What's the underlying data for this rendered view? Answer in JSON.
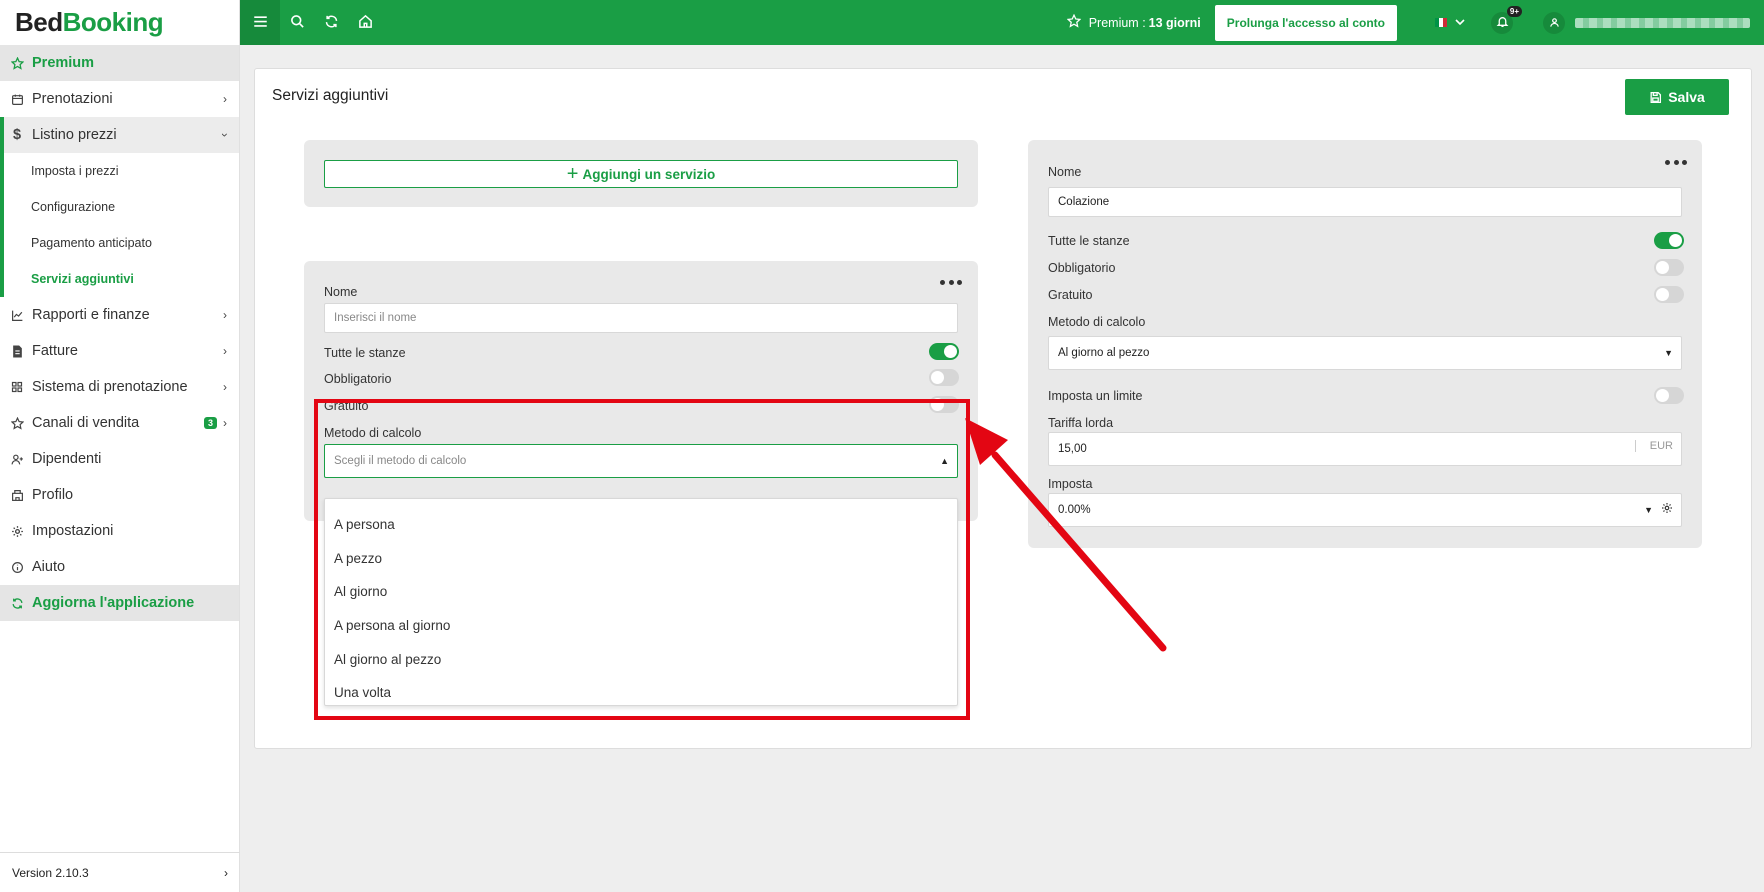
{
  "sidebar": {
    "logo_part1": "Bed",
    "logo_part2": "Booking",
    "premium": "Premium",
    "items": [
      {
        "label": "Prenotazioni"
      },
      {
        "label": "Listino prezzi"
      },
      {
        "label": "Rapporti e finanze"
      },
      {
        "label": "Fatture"
      },
      {
        "label": "Sistema di prenotazione"
      },
      {
        "label": "Canali di vendita",
        "badge": "3"
      },
      {
        "label": "Dipendenti"
      },
      {
        "label": "Profilo"
      },
      {
        "label": "Impostazioni"
      },
      {
        "label": "Aiuto"
      }
    ],
    "subitems": [
      {
        "label": "Imposta i prezzi"
      },
      {
        "label": "Configurazione"
      },
      {
        "label": "Pagamento anticipato"
      },
      {
        "label": "Servizi aggiuntivi"
      }
    ],
    "update": "Aggiorna l'applicazione",
    "version": "Version 2.10.3"
  },
  "topbar": {
    "premium_label": "Premium :",
    "premium_days": "13 giorni",
    "extend_button": "Prolunga l'accesso al conto",
    "notifications_badge": "9+"
  },
  "page": {
    "title": "Servizi aggiuntivi",
    "save_button": "Salva"
  },
  "add_service": {
    "button": "Aggiungi un servizio"
  },
  "new_service": {
    "name_label": "Nome",
    "name_placeholder": "Inserisci il nome",
    "all_rooms_label": "Tutte le stanze",
    "all_rooms": true,
    "mandatory_label": "Obbligatorio",
    "mandatory": false,
    "free_label": "Gratuito",
    "free": false,
    "method_label": "Metodo di calcolo",
    "method_placeholder": "Scegli il metodo di calcolo",
    "method_options": [
      "A persona",
      "A pezzo",
      "Al giorno",
      "A persona al giorno",
      "Al giorno al pezzo",
      "Una volta"
    ]
  },
  "existing_service": {
    "name_label": "Nome",
    "name_value": "Colazione",
    "all_rooms_label": "Tutte le stanze",
    "all_rooms": true,
    "mandatory_label": "Obbligatorio",
    "mandatory": false,
    "free_label": "Gratuito",
    "free": false,
    "method_label": "Metodo di calcolo",
    "method_value": "Al giorno al pezzo",
    "limit_label": "Imposta un limite",
    "limit": false,
    "gross_rate_label": "Tariffa lorda",
    "gross_rate_value": "15,00",
    "currency": "EUR",
    "tax_label": "Imposta",
    "tax_value": "0.00%"
  },
  "colors": {
    "brand_green": "#1a9e45",
    "highlight_red": "#e30613"
  }
}
